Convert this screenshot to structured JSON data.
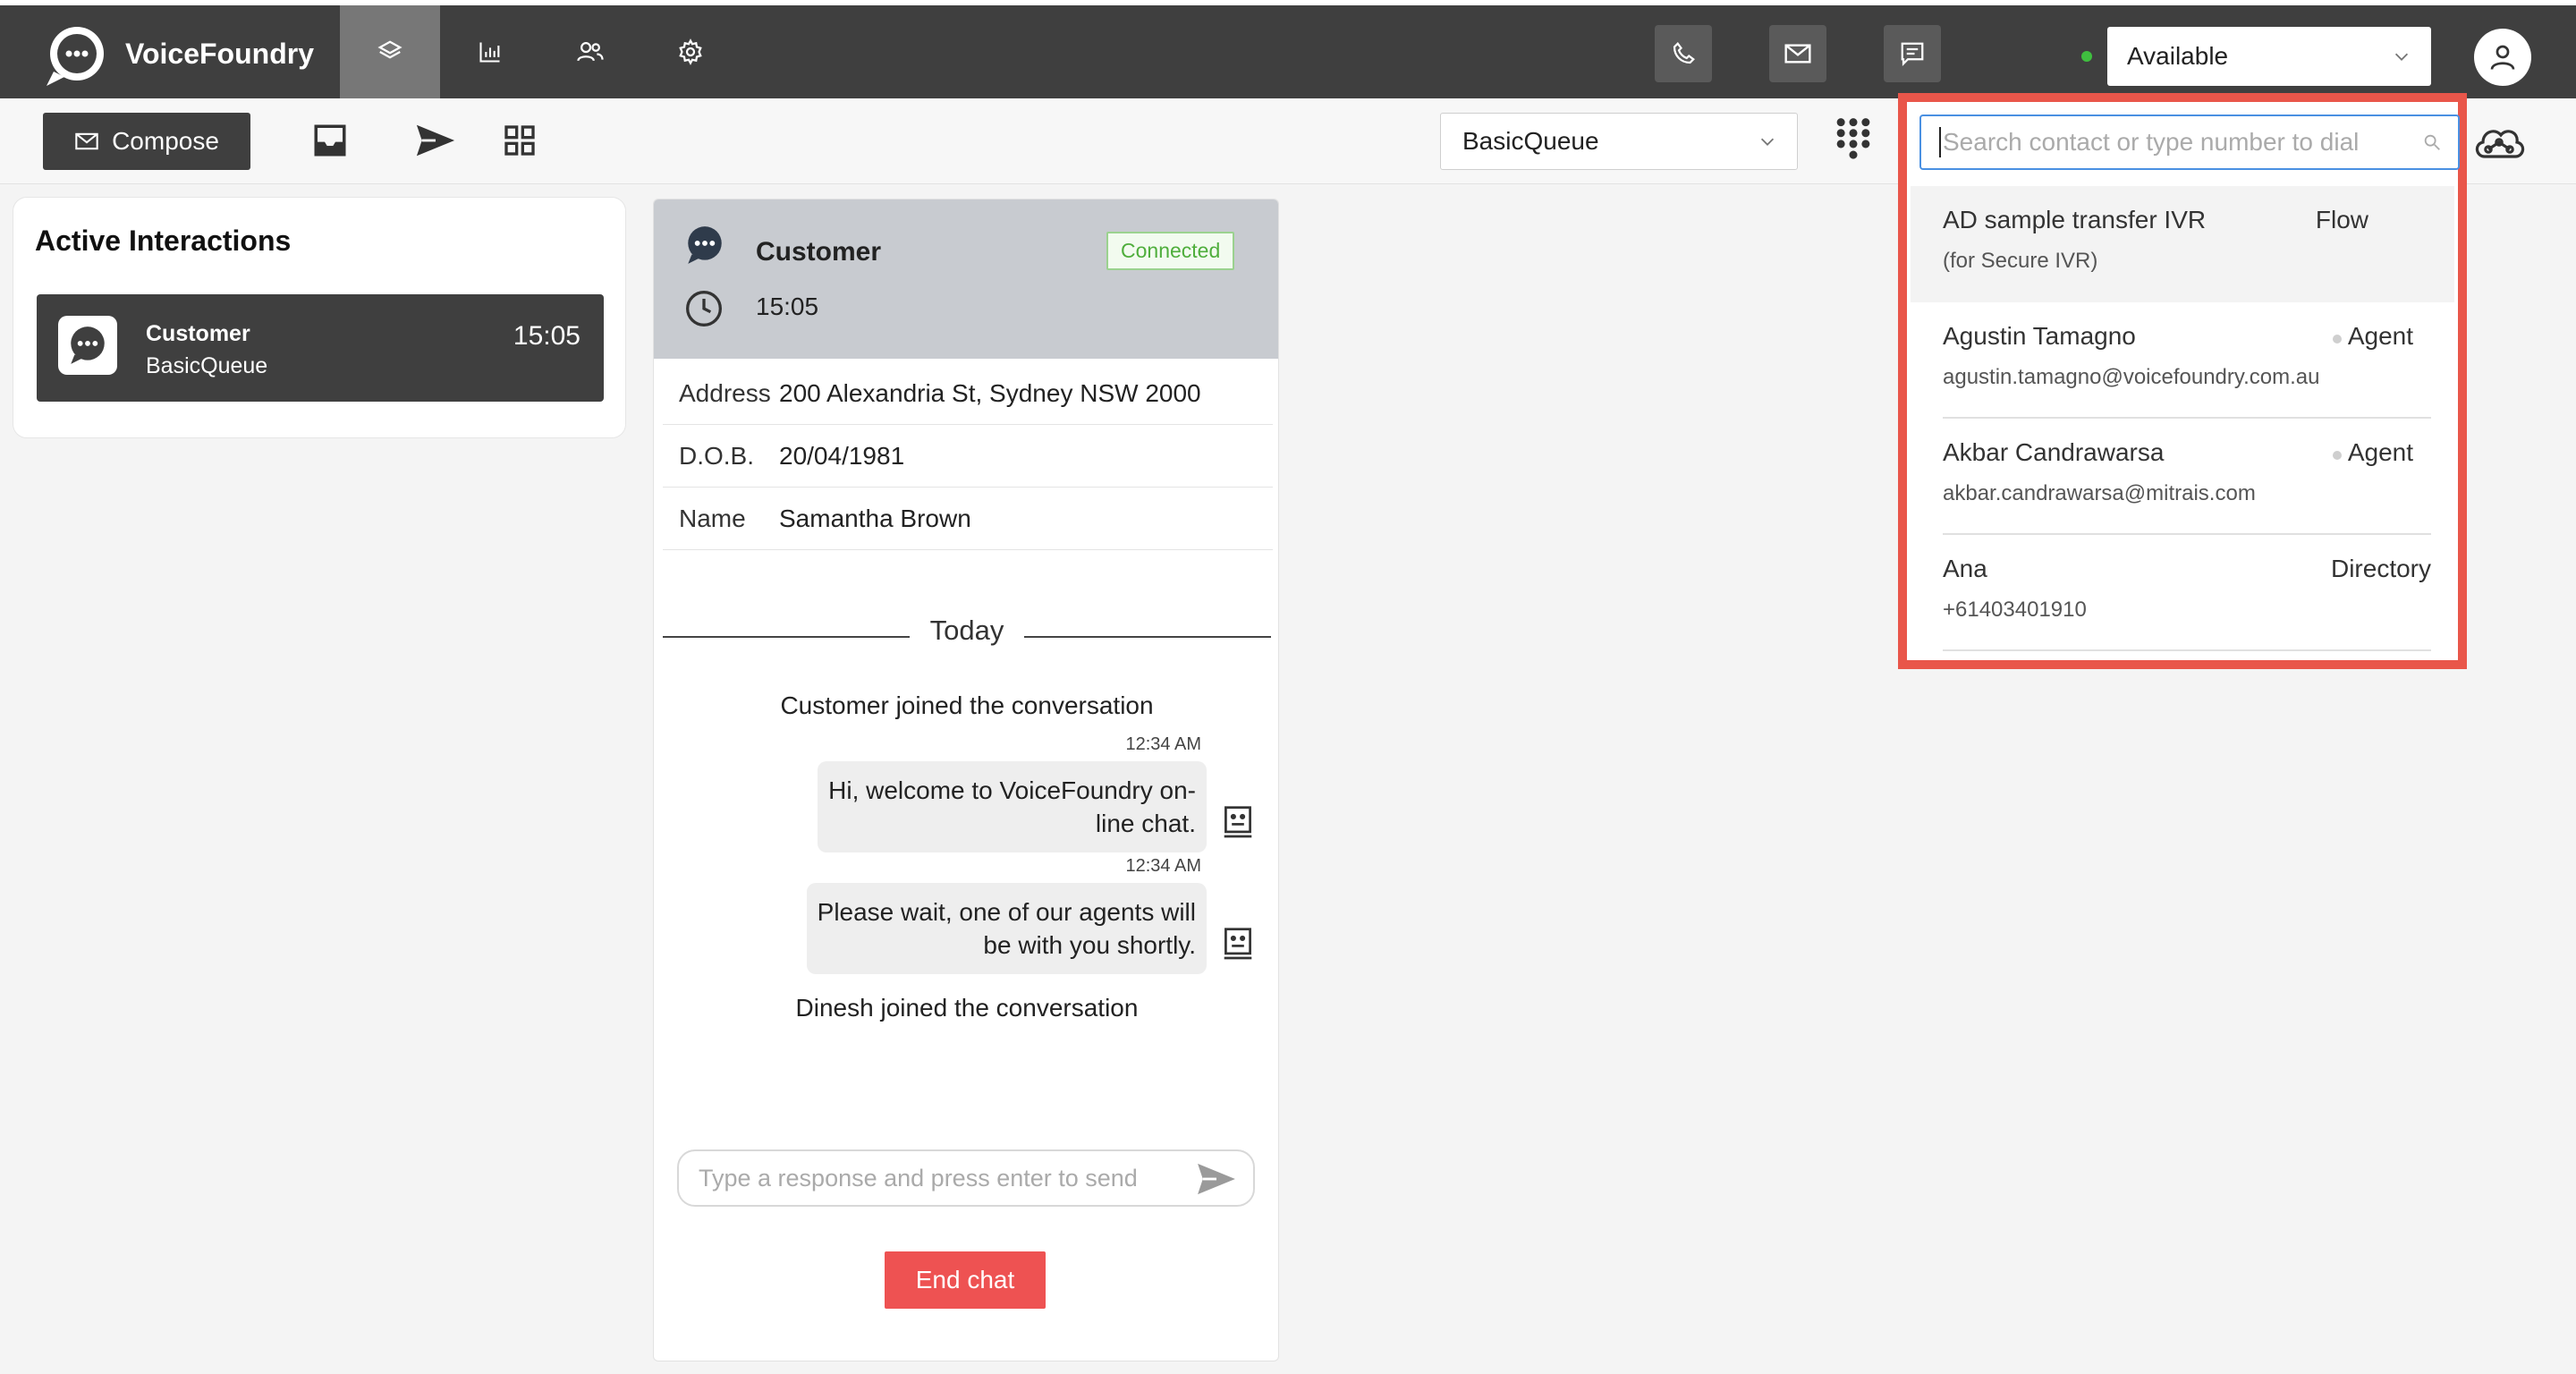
{
  "app": {
    "name": "VoiceFoundry"
  },
  "colors": {
    "topbar": "#3f3f3f",
    "accent_red": "#ee5252",
    "highlight_border": "#e9564a",
    "status_green": "#3fbf3f",
    "connected_green": "#4fae3c"
  },
  "nav": {
    "tabs": [
      {
        "icon": "layers-icon",
        "active": true
      },
      {
        "icon": "bar-chart-icon",
        "active": false
      },
      {
        "icon": "users-icon",
        "active": false
      },
      {
        "icon": "gear-icon",
        "active": false
      }
    ]
  },
  "header": {
    "status": "Available"
  },
  "toolbar": {
    "compose_label": "Compose",
    "queue": "BasicQueue"
  },
  "active_interactions": {
    "title": "Active Interactions",
    "items": [
      {
        "name": "Customer",
        "queue": "BasicQueue",
        "time": "15:05"
      }
    ]
  },
  "chat": {
    "customer_name": "Customer",
    "status_badge": "Connected",
    "elapsed": "15:05",
    "info": [
      {
        "label": "Address",
        "value": "200 Alexandria St, Sydney NSW 2000"
      },
      {
        "label": "D.O.B.",
        "value": "20/04/1981"
      },
      {
        "label": "Name",
        "value": "Samantha Brown"
      }
    ],
    "divider": "Today",
    "events": [
      {
        "text": "Customer joined the conversation"
      },
      {
        "time": "12:34 AM",
        "lines": [
          "Hi, welcome to VoiceFoundry on-",
          "line chat."
        ]
      },
      {
        "time": "12:34 AM",
        "lines": [
          "Please wait, one of our agents will",
          "be with you shortly."
        ]
      },
      {
        "text": "Dinesh joined the conversation"
      }
    ],
    "input_placeholder": "Type a response and press enter to send",
    "end_chat_label": "End chat"
  },
  "search": {
    "placeholder": "Search contact or type number to dial",
    "results": [
      {
        "name": "AD sample transfer IVR",
        "sub": "(for Secure IVR)",
        "type": "Flow"
      },
      {
        "name": "Agustin Tamagno",
        "sub": "agustin.tamagno@voicefoundry.com.au",
        "type": "Agent"
      },
      {
        "name": "Akbar Candrawarsa",
        "sub": "akbar.candrawarsa@mitrais.com",
        "type": "Agent"
      },
      {
        "name": "Ana",
        "sub": "+61403401910",
        "type": "Directory"
      }
    ]
  }
}
